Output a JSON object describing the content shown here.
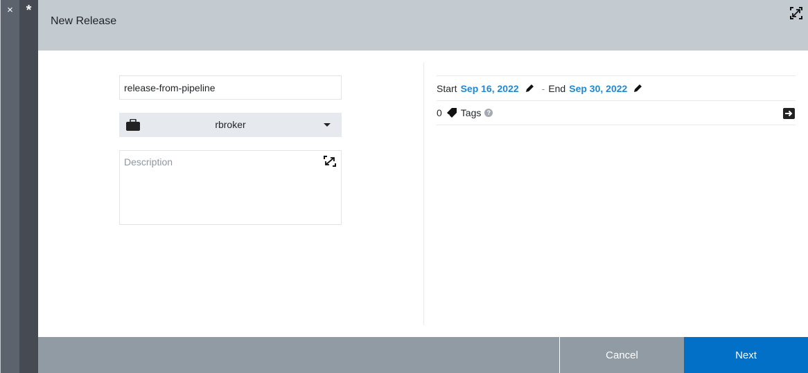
{
  "rail": {
    "close_glyph": "×",
    "pin_glyph": "*"
  },
  "header": {
    "title": "New Release",
    "maximize_icon": "maximize-icon"
  },
  "form": {
    "name_value": "release-from-pipeline",
    "project_select": {
      "icon": "briefcase-icon",
      "value": "rbroker"
    },
    "description": {
      "value": "",
      "placeholder": "Description",
      "expand_icon": "expand-icon"
    }
  },
  "details": {
    "start_label": "Start",
    "start_date": "Sep 16, 2022",
    "separator": "-",
    "end_label": "End",
    "end_date": "Sep 30, 2022",
    "tags_count": "0",
    "tags_label": "Tags",
    "help_glyph": "?"
  },
  "footer": {
    "cancel_label": "Cancel",
    "next_label": "Next"
  },
  "colors": {
    "accent": "#0270c7",
    "link": "#1e88d2",
    "header_bg": "#c3cad0",
    "footer_bg": "#919ba3"
  }
}
